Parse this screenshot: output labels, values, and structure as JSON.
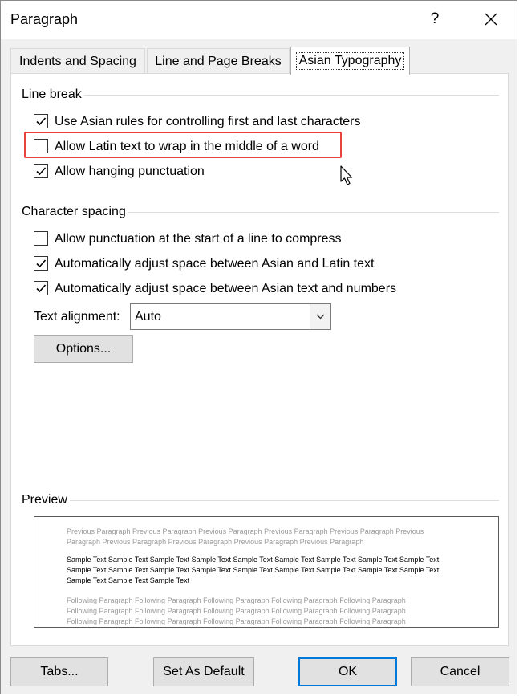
{
  "window": {
    "title": "Paragraph",
    "help": "?"
  },
  "tabs": [
    {
      "label": "Indents and Spacing",
      "active": false
    },
    {
      "label": "Line and Page Breaks",
      "active": false
    },
    {
      "label": "Asian Typography",
      "active": true
    }
  ],
  "line_break": {
    "heading": "Line break",
    "options": [
      {
        "label": "Use Asian rules for controlling first and last characters",
        "checked": true
      },
      {
        "label": "Allow Latin text to wrap in the middle of a word",
        "checked": false
      },
      {
        "label": "Allow hanging punctuation",
        "checked": true
      }
    ]
  },
  "character_spacing": {
    "heading": "Character spacing",
    "options": [
      {
        "label": "Allow punctuation at the start of a line to compress",
        "checked": false
      },
      {
        "label": "Automatically adjust space between Asian and Latin text",
        "checked": true
      },
      {
        "label": "Automatically adjust space between Asian text and numbers",
        "checked": true
      }
    ],
    "text_alignment_label": "Text alignment:",
    "text_alignment_value": "Auto",
    "options_button": "Options..."
  },
  "preview": {
    "heading": "Preview",
    "previous_lines": [
      "Previous Paragraph Previous Paragraph Previous Paragraph Previous Paragraph Previous Paragraph Previous",
      "Paragraph Previous Paragraph Previous Paragraph Previous Paragraph Previous Paragraph"
    ],
    "sample_lines": [
      "Sample Text Sample Text Sample Text Sample Text Sample Text Sample Text Sample Text Sample Text Sample Text",
      "Sample Text Sample Text Sample Text Sample Text Sample Text Sample Text Sample Text Sample Text Sample Text",
      "Sample Text Sample Text Sample Text"
    ],
    "following_lines": [
      "Following Paragraph Following Paragraph Following Paragraph Following Paragraph Following Paragraph",
      "Following Paragraph Following Paragraph Following Paragraph Following Paragraph Following Paragraph",
      "Following Paragraph Following Paragraph Following Paragraph Following Paragraph Following Paragraph"
    ]
  },
  "footer": {
    "tabs_button": "Tabs...",
    "set_default_button": "Set As Default",
    "ok_button": "OK",
    "cancel_button": "Cancel"
  },
  "colors": {
    "highlight": "#e8423f",
    "default_button_border": "#0078d7"
  },
  "icons": [
    "close-icon",
    "checkmark-icon",
    "chevron-down-icon",
    "mouse-pointer-icon"
  ]
}
